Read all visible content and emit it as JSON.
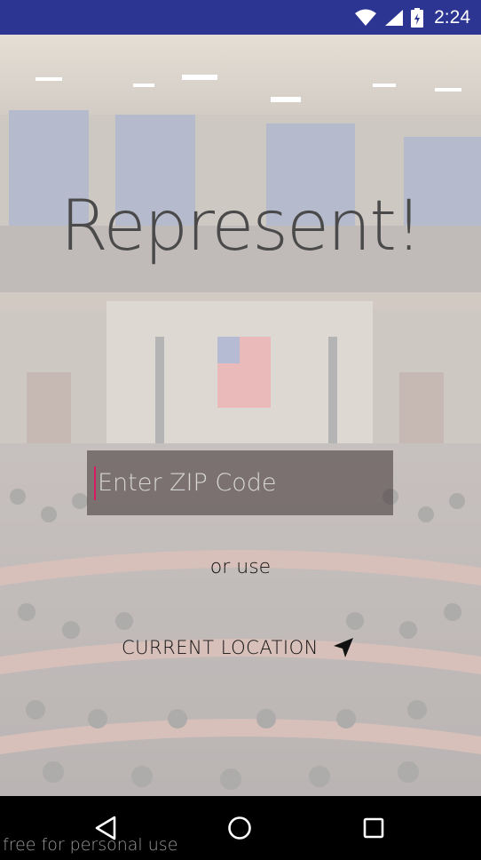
{
  "status_bar": {
    "time": "2:24",
    "icons": [
      "wifi-icon",
      "cell-signal-icon",
      "battery-icon"
    ],
    "background": "#2c3592"
  },
  "app": {
    "title": "Represent!",
    "zip_input": {
      "value": "",
      "placeholder": "Enter ZIP Code",
      "cursor_color": "#d81b60"
    },
    "separator_text": "or use",
    "location_button": {
      "label": "CURRENT LOCATION",
      "icon": "navigation-arrow-icon"
    },
    "background": "chamber-photo"
  },
  "nav_bar": {
    "buttons": [
      "back-triangle-icon",
      "home-circle-icon",
      "recents-square-icon"
    ]
  },
  "watermark": "free for personal use"
}
